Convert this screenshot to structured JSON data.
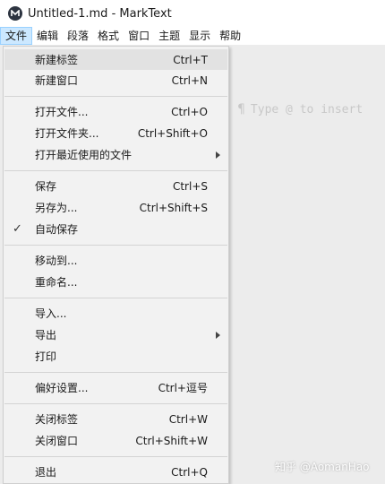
{
  "window": {
    "title": "Untitled-1.md - MarkText",
    "icon": "marktext-logo-icon"
  },
  "menubar": {
    "items": [
      "文件",
      "编辑",
      "段落",
      "格式",
      "窗口",
      "主题",
      "显示",
      "帮助"
    ],
    "active_index": 0
  },
  "editor": {
    "placeholder_symbol": "¶",
    "placeholder_text": "Type @ to insert"
  },
  "file_menu": {
    "items": [
      {
        "label": "新建标签",
        "shortcut": "Ctrl+T",
        "highlighted": true
      },
      {
        "label": "新建窗口",
        "shortcut": "Ctrl+N"
      },
      {
        "label": "打开文件...",
        "shortcut": "Ctrl+O"
      },
      {
        "label": "打开文件夹...",
        "shortcut": "Ctrl+Shift+O"
      },
      {
        "label": "打开最近使用的文件",
        "shortcut": "",
        "submenu": true
      },
      {
        "label": "保存",
        "shortcut": "Ctrl+S"
      },
      {
        "label": "另存为...",
        "shortcut": "Ctrl+Shift+S"
      },
      {
        "label": "自动保存",
        "shortcut": "",
        "checked": true
      },
      {
        "label": "移动到...",
        "shortcut": ""
      },
      {
        "label": "重命名...",
        "shortcut": ""
      },
      {
        "label": "导入...",
        "shortcut": ""
      },
      {
        "label": "导出",
        "shortcut": "",
        "submenu": true
      },
      {
        "label": "打印",
        "shortcut": ""
      },
      {
        "label": "偏好设置...",
        "shortcut": "Ctrl+逗号"
      },
      {
        "label": "关闭标签",
        "shortcut": "Ctrl+W"
      },
      {
        "label": "关闭窗口",
        "shortcut": "Ctrl+Shift+W"
      },
      {
        "label": "退出",
        "shortcut": "Ctrl+Q"
      }
    ],
    "check_mark": "✓"
  },
  "watermark": "知乎 @AomanHao",
  "colors": {
    "menu_bg": "#f2f2f2",
    "highlight_bg": "#e2e2e2",
    "menubar_active_bg": "#cce8ff",
    "editor_bg": "#ececec"
  }
}
